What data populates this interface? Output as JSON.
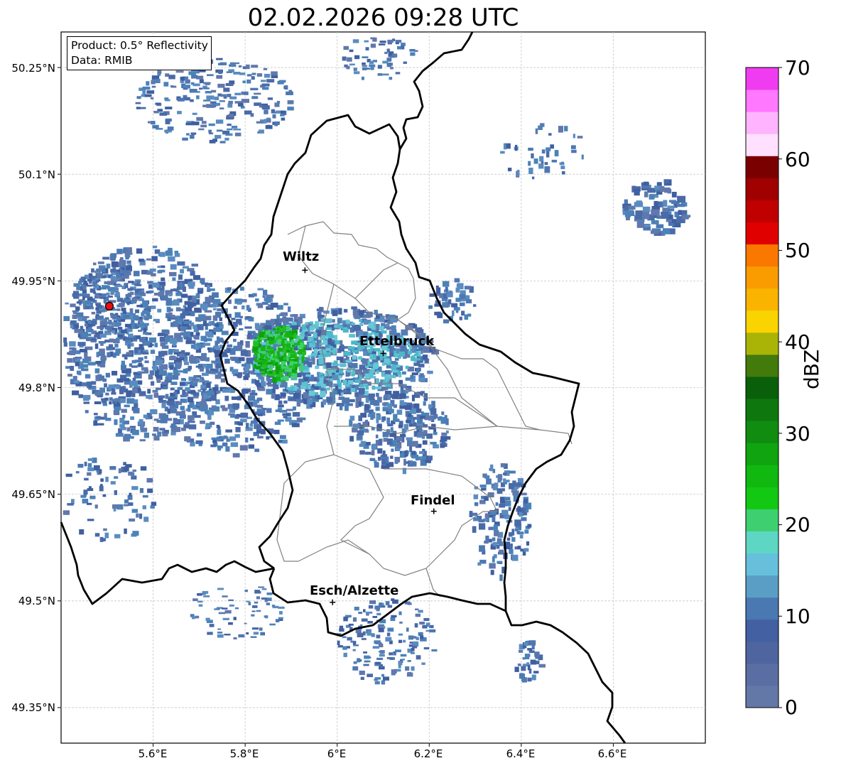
{
  "title": "02.02.2026 09:28 UTC",
  "info": {
    "product": "Product: 0.5° Reflectivity",
    "data": "Data: RMIB"
  },
  "axes": {
    "y_ticks": [
      "50.25°N",
      "50.1°N",
      "49.95°N",
      "49.8°N",
      "49.65°N",
      "49.5°N",
      "49.35°N"
    ],
    "x_ticks": [
      "5.6°E",
      "5.8°E",
      "6°E",
      "6.2°E",
      "6.4°E",
      "6.6°E"
    ]
  },
  "cities": [
    {
      "name": "Wiltz",
      "lon": 5.93,
      "lat": 49.965
    },
    {
      "name": "Ettelbruck",
      "lon": 6.1,
      "lat": 49.848
    },
    {
      "name": "Findel",
      "lon": 6.21,
      "lat": 49.626
    },
    {
      "name": "Esch/Alzette",
      "lon": 5.99,
      "lat": 49.498
    }
  ],
  "radar_site": {
    "lon": 5.505,
    "lat": 49.915,
    "color": "#e81010"
  },
  "colorbar": {
    "label": "dBZ",
    "ticks": [
      "70",
      "60",
      "50",
      "40",
      "30",
      "20",
      "10",
      "0"
    ],
    "min": 0,
    "max": 70,
    "colors": [
      "#6478a8",
      "#5a6ea4",
      "#4e65a0",
      "#4360a3",
      "#4a78b0",
      "#5a9ec6",
      "#66c0dc",
      "#5ed6c4",
      "#3ed070",
      "#12c812",
      "#10b810",
      "#10a410",
      "#108c10",
      "#0e780e",
      "#0a600a",
      "#427a0c",
      "#aab406",
      "#fad400",
      "#fab400",
      "#fa9c00",
      "#fa7800",
      "#e00000",
      "#c00000",
      "#a00000",
      "#7a0000",
      "#ffe0ff",
      "#ffb4ff",
      "#ff78ff",
      "#f03cf0"
    ]
  },
  "map_extent": {
    "lon_min": 5.4,
    "lon_max": 6.8,
    "lat_min": 49.3,
    "lat_max": 50.3
  }
}
